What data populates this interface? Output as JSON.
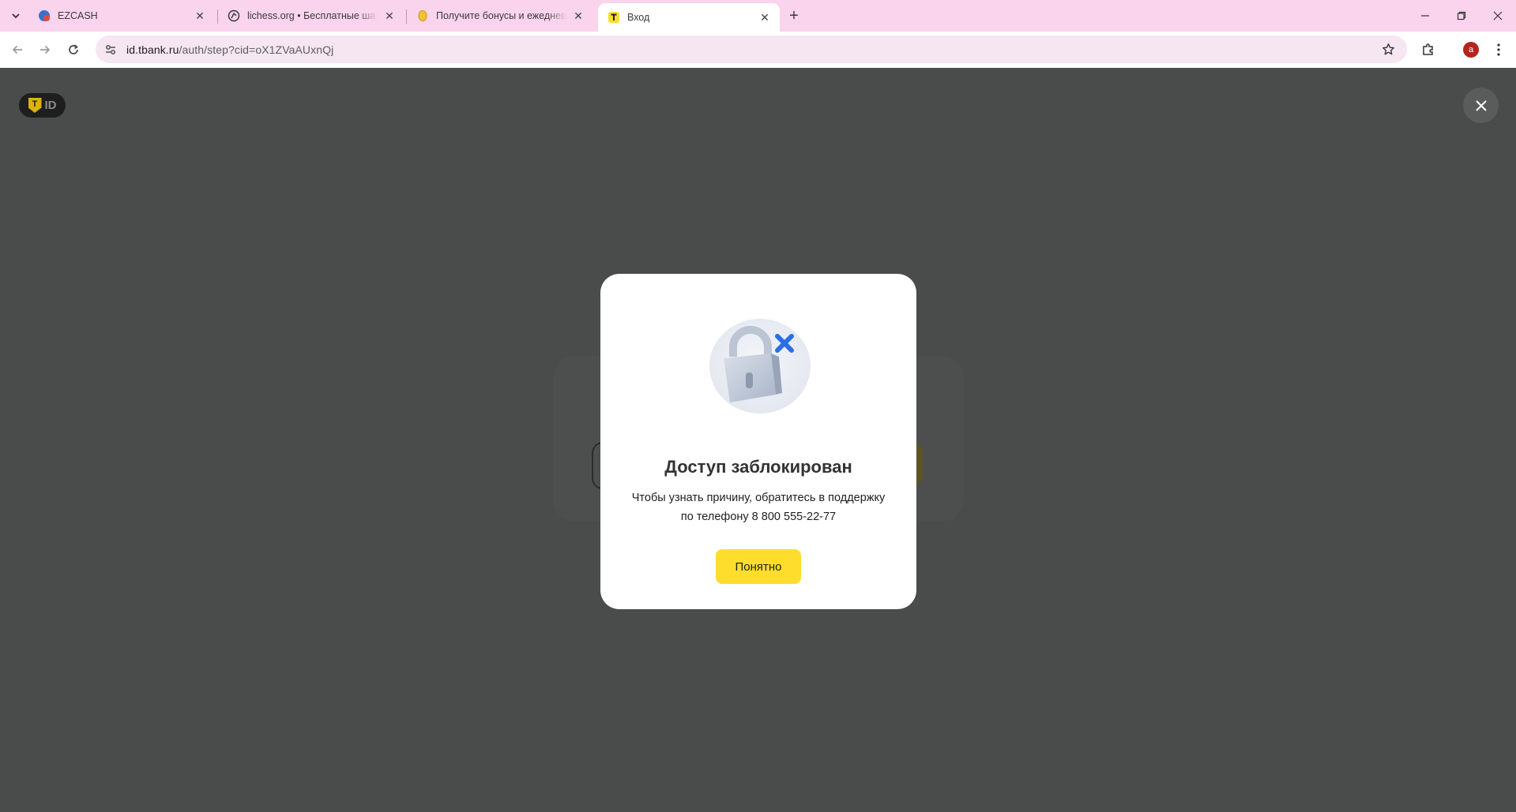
{
  "browser": {
    "tabs": [
      {
        "title": "EZCASH",
        "active": false,
        "favicon": "ezcash-logo-icon"
      },
      {
        "title": "lichess.org • Бесплатные шахм",
        "active": false,
        "favicon": "lichess-knight-icon"
      },
      {
        "title": "Получите бонусы и ежедневн",
        "active": false,
        "favicon": "coin-icon"
      },
      {
        "title": "Вход",
        "active": true,
        "favicon": "tbank-logo-icon"
      }
    ],
    "url_host": "id.tbank.ru",
    "url_path": "/auth/step?cid=oX1ZVaAUxnQj",
    "profile_initial": "a",
    "colors": {
      "tabstrip": "#f9d4ec",
      "omnibox": "#f5e6f1",
      "avatar": "#b3261e"
    }
  },
  "page": {
    "logo_letter": "T",
    "logo_text": "ID",
    "background": "#4a4c4c"
  },
  "modal": {
    "title": "Доступ заблокирован",
    "line1": "Чтобы узнать причину, обратитесь в поддержку",
    "line2": "по телефону 8 800 555-22-77",
    "button_label": "Понятно",
    "button_color": "#ffdd2d",
    "illustration": "locked-padlock-icon"
  }
}
